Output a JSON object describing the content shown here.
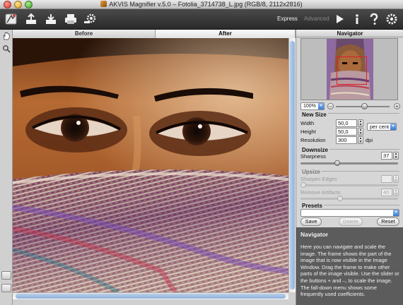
{
  "window": {
    "title": "AKVIS Magnifier v.5.0 – Fotolia_3714738_L.jpg (RGB/8, 2112x2816)"
  },
  "toolbar": {
    "mode_express": "Express",
    "mode_advanced": "Advanced",
    "icons": [
      "magnifier-logo-icon",
      "open-icon",
      "save-icon",
      "print-icon",
      "settings-gear-icon",
      "run-icon",
      "info-icon",
      "help-icon",
      "preferences-icon"
    ]
  },
  "tabs": {
    "before": "Before",
    "after": "After",
    "active": "After"
  },
  "navigator": {
    "title": "Navigator",
    "zoom": "100%"
  },
  "new_size": {
    "label": "New Size",
    "width_label": "Width",
    "width_value": "50,0",
    "height_label": "Height",
    "height_value": "50,0",
    "unit": "per cent",
    "resolution_label": "Resolution",
    "resolution_value": "300",
    "resolution_unit": "dpi"
  },
  "downsize": {
    "label": "Downsize",
    "sharpness_label": "Sharpness",
    "sharpness_value": "37",
    "sharpness_max": 100
  },
  "upsize": {
    "label": "Upsize",
    "sharpen_edges_label": "Sharpen Edges",
    "sharpen_edges_value": "",
    "remove_artifacts_label": "Remove Artifacts",
    "remove_artifacts_value": "40"
  },
  "presets": {
    "label": "Presets",
    "selected": "",
    "save": "Save",
    "delete": "Delete",
    "reset": "Reset"
  },
  "help": {
    "title": "Navigator",
    "text": "Here you can navigate and scale the image. The frame shows the part of the image that is now visible in the Image Window. Drag the frame to make other parts of the image visible. Use the slider or the buttons + and –, to scale the image. The fall-down menu shows some frequently used coefficients."
  },
  "colors": {
    "toolbar_bg": "#2f2f2f",
    "help_bg": "#5c5c5c",
    "accent": "#3a7cd6",
    "frame": "#dd2222"
  }
}
